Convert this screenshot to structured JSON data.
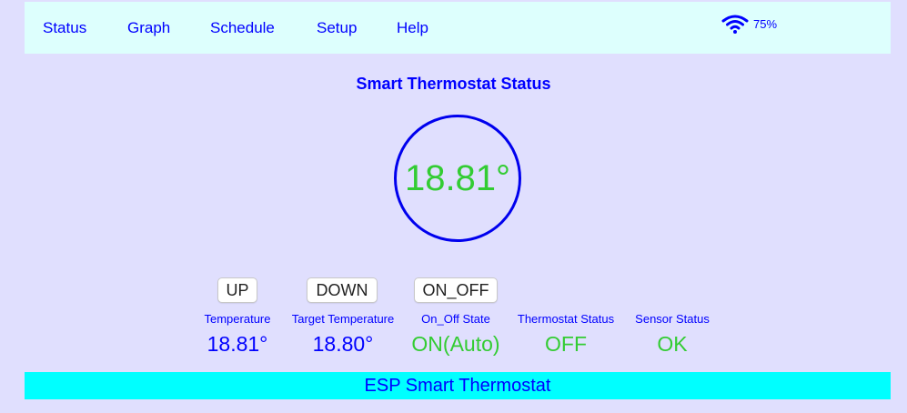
{
  "nav": {
    "status": "Status",
    "graph": "Graph",
    "schedule": "Schedule",
    "setup": "Setup",
    "help": "Help",
    "wifi_icon": "wifi-icon",
    "wifi_signal": "75%"
  },
  "title": "Smart Thermostat Status",
  "dial": {
    "temperature": "18.81°"
  },
  "buttons": {
    "up": "UP",
    "down": "DOWN",
    "on_off": "ON_OFF"
  },
  "stats": [
    {
      "label": "Temperature",
      "value": "18.81°"
    },
    {
      "label": "Target Temperature",
      "value": "18.80°"
    },
    {
      "label": "On_Off State",
      "value": "ON(Auto)"
    },
    {
      "label": "Thermostat Status",
      "value": "OFF"
    },
    {
      "label": "Sensor Status",
      "value": "OK"
    }
  ],
  "footer": "ESP Smart Thermostat",
  "colors": {
    "background": "#e0dffe",
    "nav_background": "#ddfffd",
    "link": "#0000ff",
    "ok_green": "#33cc33",
    "footer_background": "#00ffff"
  }
}
